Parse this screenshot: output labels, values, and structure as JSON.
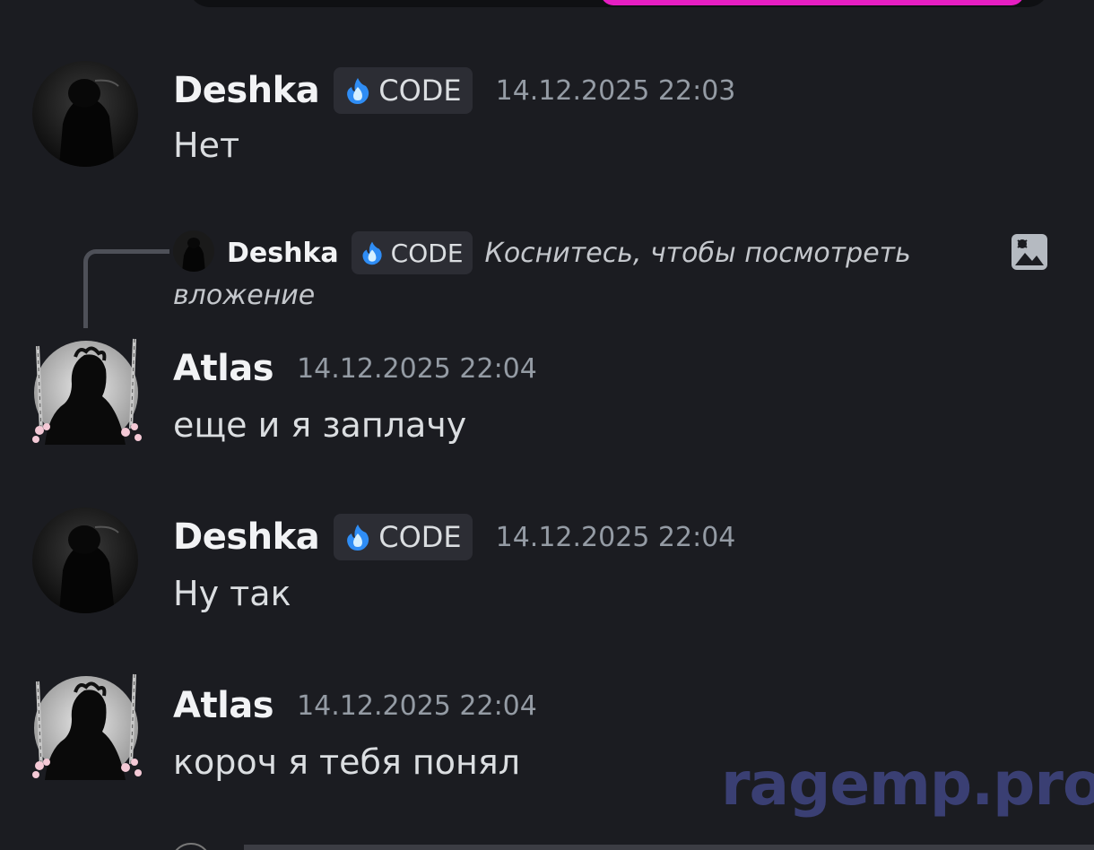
{
  "messages": [
    {
      "username": "Deshka",
      "tag": "CODE",
      "timestamp": "14.12.2025 22:03",
      "text": "Нет"
    },
    {
      "reply": {
        "username": "Deshka",
        "tag": "CODE",
        "text_line1": "Коснитесь, чтобы посмотреть",
        "text_line2": "вложение",
        "attachment_icon": "image-icon"
      },
      "username": "Atlas",
      "timestamp": "14.12.2025 22:04",
      "text": "еще и я заплачу"
    },
    {
      "username": "Deshka",
      "tag": "CODE",
      "timestamp": "14.12.2025 22:04",
      "text": "Ну так"
    },
    {
      "username": "Atlas",
      "timestamp": "14.12.2025 22:04",
      "text": "короч я тебя понял"
    }
  ],
  "watermark": "ragemp.pro",
  "colors": {
    "background": "#1b1c21",
    "tag_background": "#2c2d34",
    "timestamp": "#949ba4",
    "accent_pink": "#e61ec2",
    "watermark": "#3a3f73"
  }
}
